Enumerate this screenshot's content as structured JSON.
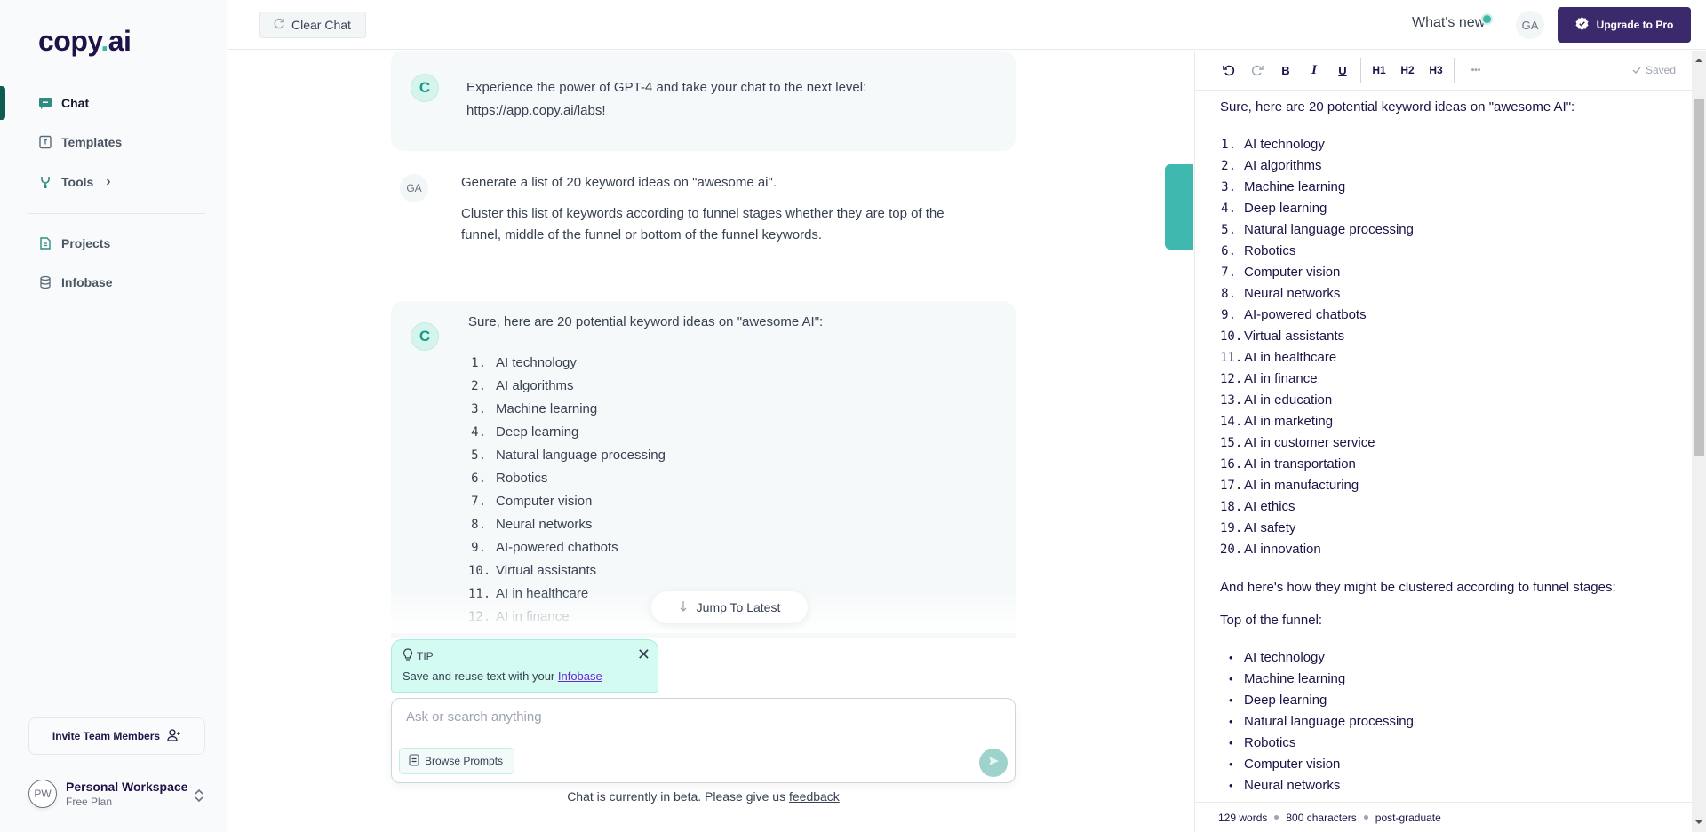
{
  "brand": {
    "logo_main": "copy",
    "logo_dot": ".",
    "logo_tail": "ai",
    "accent": "#3fb8a8",
    "primary": "#3a2a6b"
  },
  "sidebar": {
    "items": [
      {
        "label": "Chat",
        "icon": "chat-icon",
        "active": true
      },
      {
        "label": "Templates",
        "icon": "template-icon"
      },
      {
        "label": "Tools",
        "icon": "tools-icon",
        "chevron": "›"
      },
      {
        "label": "Projects",
        "icon": "document-icon"
      },
      {
        "label": "Infobase",
        "icon": "database-icon"
      }
    ],
    "invite_label": "Invite Team Members",
    "workspace": {
      "initials": "PW",
      "name": "Personal Workspace",
      "plan": "Free Plan"
    }
  },
  "topbar": {
    "clear_chat": "Clear Chat",
    "whats_new": "What's new",
    "user_initials": "GA",
    "upgrade": "Upgrade to Pro"
  },
  "chat": {
    "bot_avatar": "C",
    "promo": {
      "line1": "Experience the power of GPT-4 and take your chat to the next level:",
      "line2": "https://app.copy.ai/labs!"
    },
    "user": {
      "initials": "GA",
      "line1": "Generate a list of 20 keyword ideas on \"awesome ai\".",
      "line2": "Cluster this list of keywords according to funnel stages whether they are top of the",
      "line3": "funnel, middle of the funnel or bottom of the funnel keywords."
    },
    "response_intro": "Sure, here are 20 potential keyword ideas on \"awesome AI\":",
    "visible_items": [
      {
        "n": "1.",
        "t": "AI technology"
      },
      {
        "n": "2.",
        "t": "AI algorithms"
      },
      {
        "n": "3.",
        "t": "Machine learning"
      },
      {
        "n": "4.",
        "t": "Deep learning"
      },
      {
        "n": "5.",
        "t": "Natural language processing"
      },
      {
        "n": "6.",
        "t": "Robotics"
      },
      {
        "n": "7.",
        "t": "Computer vision"
      },
      {
        "n": "8.",
        "t": "Neural networks"
      },
      {
        "n": "9.",
        "t": "AI-powered chatbots"
      },
      {
        "n": "10.",
        "t": "Virtual assistants"
      },
      {
        "n": "11.",
        "t": "AI in healthcare"
      },
      {
        "n": "12.",
        "t": "AI in finance"
      }
    ],
    "jump_latest": "Jump To Latest",
    "tip": {
      "label": "TIP",
      "text": "Save and reuse text with your ",
      "link": "Infobase"
    },
    "input_placeholder": "Ask or search anything",
    "input_value": "",
    "browse_prompts": "Browse Prompts",
    "beta_text": "Chat is currently in beta. Please give us ",
    "beta_link": "feedback"
  },
  "close_tab": "Close",
  "editor": {
    "toolbar": {
      "bold": "B",
      "italic": "I",
      "underline": "U",
      "h1": "H1",
      "h2": "H2",
      "h3": "H3",
      "more": "•••",
      "saved": "Saved"
    },
    "intro": "Sure, here are 20 potential keyword ideas on \"awesome AI\":",
    "keywords": [
      {
        "n": "1.",
        "t": "AI technology"
      },
      {
        "n": "2.",
        "t": "AI algorithms"
      },
      {
        "n": "3.",
        "t": "Machine learning"
      },
      {
        "n": "4.",
        "t": "Deep learning"
      },
      {
        "n": "5.",
        "t": "Natural language processing"
      },
      {
        "n": "6.",
        "t": "Robotics"
      },
      {
        "n": "7.",
        "t": "Computer vision"
      },
      {
        "n": "8.",
        "t": "Neural networks"
      },
      {
        "n": "9.",
        "t": "AI-powered chatbots"
      },
      {
        "n": "10.",
        "t": "Virtual assistants"
      },
      {
        "n": "11.",
        "t": "AI in healthcare"
      },
      {
        "n": "12.",
        "t": "AI in finance"
      },
      {
        "n": "13.",
        "t": "AI in education"
      },
      {
        "n": "14.",
        "t": "AI in marketing"
      },
      {
        "n": "15.",
        "t": "AI in customer service"
      },
      {
        "n": "16.",
        "t": "AI in transportation"
      },
      {
        "n": "17.",
        "t": "AI in manufacturing"
      },
      {
        "n": "18.",
        "t": "AI ethics"
      },
      {
        "n": "19.",
        "t": "AI safety"
      },
      {
        "n": "20.",
        "t": "AI innovation"
      }
    ],
    "cluster_intro": "And here's how they might be clustered according to funnel stages:",
    "top_heading": "Top of the funnel:",
    "top_items": [
      "AI technology",
      "Machine learning",
      "Deep learning",
      "Natural language processing",
      "Robotics",
      "Computer vision",
      "Neural networks"
    ],
    "status": {
      "words": "129 words",
      "chars": "800 characters",
      "level": "post-graduate"
    }
  }
}
